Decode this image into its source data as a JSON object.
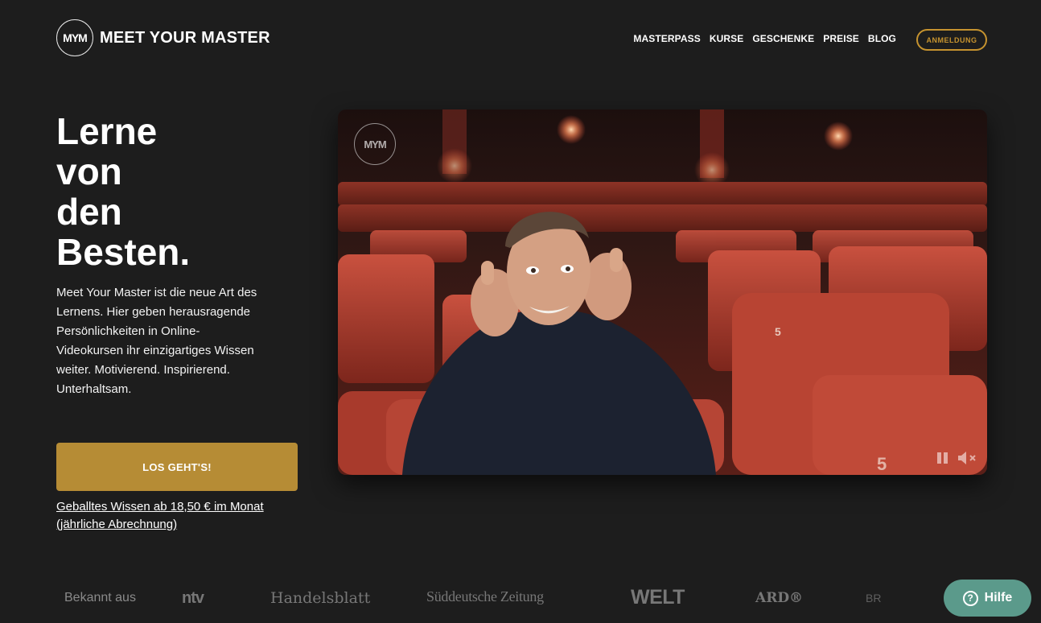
{
  "brand": {
    "mark": "MYM",
    "name": "MEET YOUR MASTER"
  },
  "nav": {
    "items": [
      {
        "label": "MASTERPASS"
      },
      {
        "label": "KURSE"
      },
      {
        "label": "GESCHENKE"
      },
      {
        "label": "PREISE"
      },
      {
        "label": "BLOG"
      }
    ],
    "login_label": "ANMELDUNG"
  },
  "hero": {
    "title_lines": [
      "Lerne",
      "von",
      "den",
      "Besten."
    ],
    "description": "Meet Your Master ist die neue Art des Lernens. Hier geben herausragende Persönlichkeiten in Online-Videokursen ihr einzigartiges Wissen weiter. Motivierend. Inspirierend. Unterhaltsam.",
    "cta_label": "LOS GEHT'S!",
    "price_link": "Geballtes Wissen ab 18,50 € im Monat (jährliche Abrechnung)"
  },
  "video": {
    "watermark": "MYM",
    "seat_numbers": [
      "5",
      "5"
    ],
    "controls": [
      "pause-icon",
      "mute-icon"
    ]
  },
  "press": {
    "label": "Bekannt aus",
    "logos": [
      "ntv",
      "Handelsblatt",
      "Süddeutsche Zeitung",
      "WELT",
      "ARD®",
      "BR"
    ]
  },
  "help": {
    "label": "Hilfe",
    "icon": "?"
  },
  "colors": {
    "background": "#1d1d1d",
    "accent_gold": "#b68c35",
    "login_border": "#c6932f",
    "help_button": "#5b9a8b"
  }
}
